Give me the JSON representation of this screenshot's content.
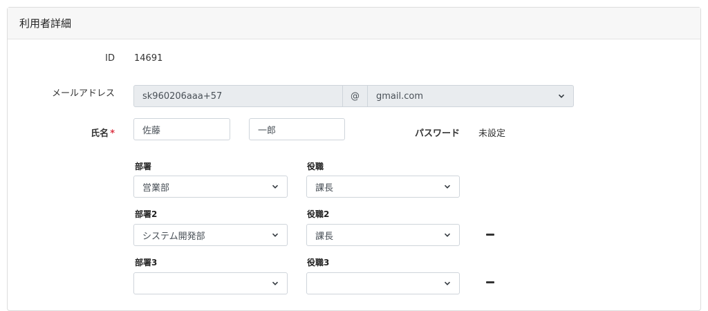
{
  "header": {
    "title": "利用者詳細"
  },
  "fields": {
    "id": {
      "label": "ID",
      "value": "14691"
    },
    "email": {
      "label": "メールアドレス",
      "local_part": "sk960206aaa+57",
      "at": "@",
      "domain": "gmail.com"
    },
    "name": {
      "label": "氏名",
      "required_mark": "*",
      "last_name": "佐藤",
      "first_name": "一郎"
    },
    "password": {
      "label": "パスワード",
      "value": "未設定"
    }
  },
  "assignments": [
    {
      "dept_label": "部署",
      "dept_value": "営業部",
      "role_label": "役職",
      "role_value": "課長",
      "removable": false
    },
    {
      "dept_label": "部署2",
      "dept_value": "システム開発部",
      "role_label": "役職2",
      "role_value": "課長",
      "removable": true
    },
    {
      "dept_label": "部署3",
      "dept_value": "",
      "role_label": "役職3",
      "role_value": "",
      "removable": true
    }
  ],
  "icons": {
    "select": "chevron-down-icon",
    "remove": "minus-icon"
  }
}
